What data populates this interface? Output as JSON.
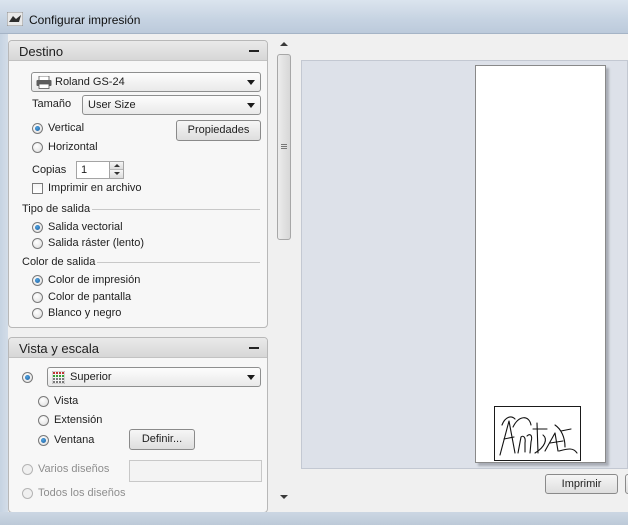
{
  "window": {
    "title": "Configurar impresión"
  },
  "destino": {
    "title": "Destino",
    "printer": "Roland GS-24",
    "size_label": "Tamaño",
    "size_value": "User Size",
    "orientation": {
      "vertical": "Vertical",
      "horizontal": "Horizontal",
      "selected": "vertical"
    },
    "properties_button": "Propiedades",
    "copies_label": "Copias",
    "copies_value": "1",
    "print_to_file": "Imprimir en archivo",
    "output_type": {
      "title": "Tipo de salida",
      "vector": "Salida vectorial",
      "raster": "Salida ráster (lento)",
      "selected": "vector"
    },
    "output_color": {
      "title": "Color de salida",
      "print_color": "Color de impresión",
      "display_color": "Color de pantalla",
      "black_white": "Blanco y negro",
      "selected": "print_color"
    }
  },
  "vista": {
    "title": "Vista y escala",
    "viewport": "Superior",
    "vista": "Vista",
    "extension": "Extensión",
    "ventana": "Ventana",
    "selected": "ventana",
    "define_button": "Definir...",
    "multiple_layouts": "Varios diseños",
    "all_layouts": "Todos los diseños"
  },
  "footer": {
    "print_button": "Imprimir"
  },
  "colors": {
    "selected_radio": "#1b5c9e",
    "preview_bg": "#dde1e9"
  }
}
